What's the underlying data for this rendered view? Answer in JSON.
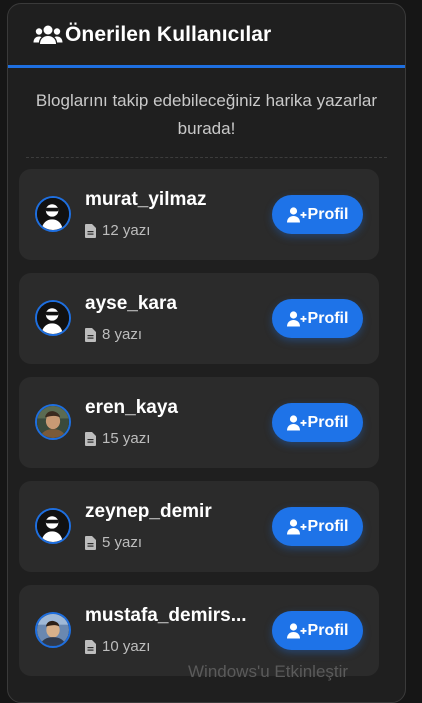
{
  "panel": {
    "title": "Önerilen Kullanıcılar",
    "header_icon": "users-icon",
    "subtitle": "Bloglarını takip edebileceğiniz harika yazarlar burada!"
  },
  "users": [
    {
      "name": "murat_yilmaz",
      "posts": "12 yazı",
      "button": "Profil",
      "avatar": "default-avatar-icon"
    },
    {
      "name": "ayse_kara",
      "posts": "8 yazı",
      "button": "Profil",
      "avatar": "default-avatar-icon"
    },
    {
      "name": "eren_kaya",
      "posts": "15 yazı",
      "button": "Profil",
      "avatar": "photo-avatar"
    },
    {
      "name": "zeynep_demir",
      "posts": "5 yazı",
      "button": "Profil",
      "avatar": "default-avatar-icon"
    },
    {
      "name": "mustafa_demirs...",
      "posts": "10 yazı",
      "button": "Profil",
      "avatar": "photo-avatar"
    }
  ],
  "icons": {
    "posts": "file-icon",
    "button": "user-plus-icon"
  },
  "colors": {
    "accent": "#1e73e8",
    "panel": "#1f1f1f",
    "card": "#2b2b2b"
  },
  "watermark": "Windows'u Etkinleştir"
}
